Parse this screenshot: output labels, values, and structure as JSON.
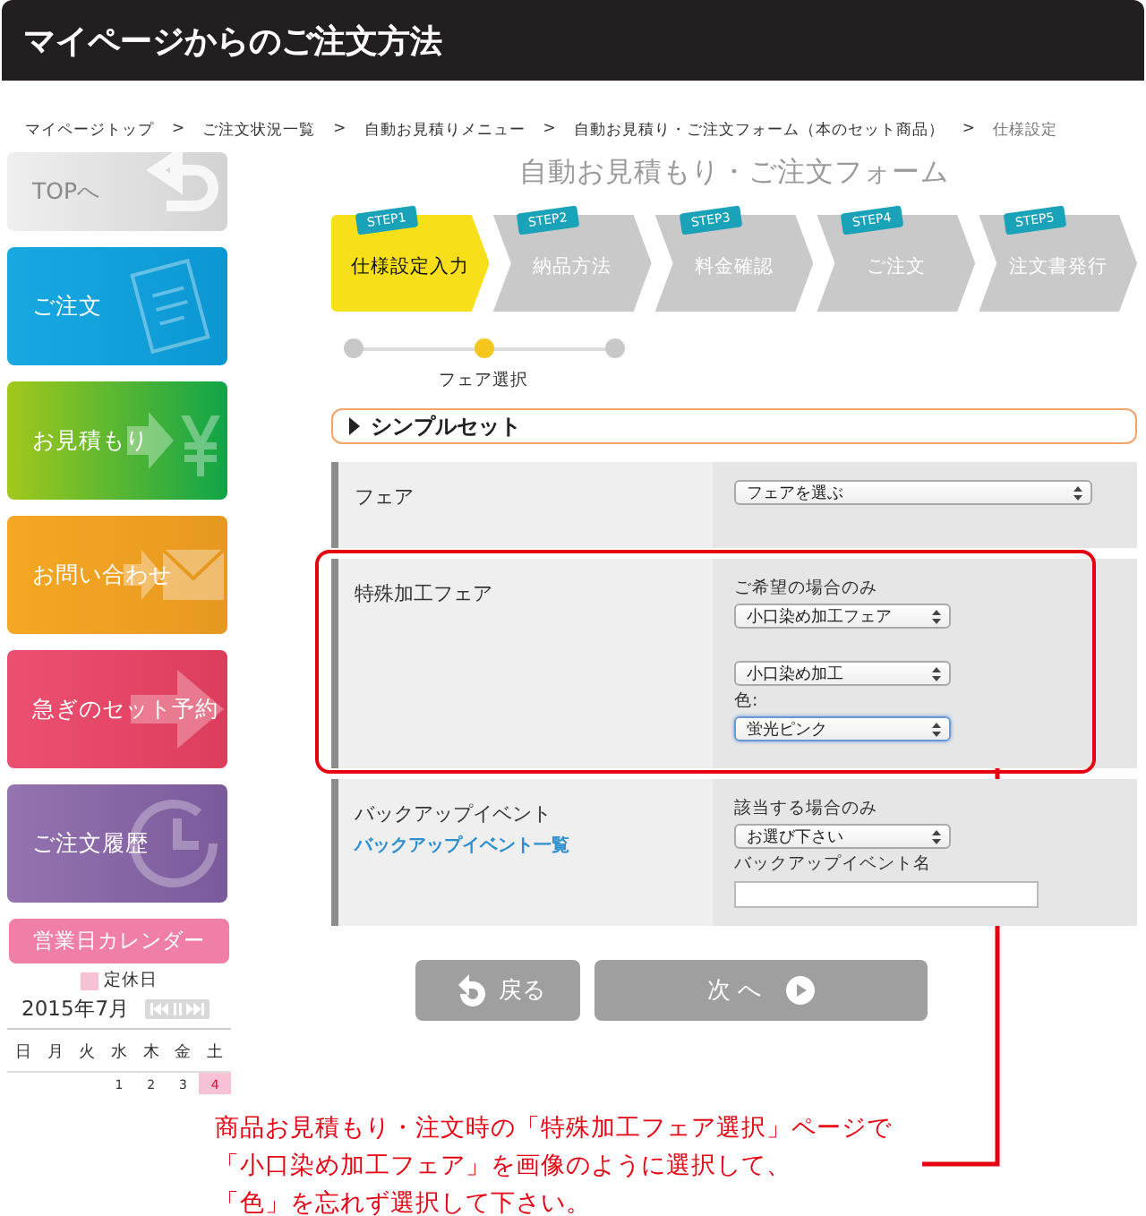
{
  "header": {
    "title": "マイページからのご注文方法"
  },
  "breadcrumb": [
    {
      "label": "マイページトップ"
    },
    {
      "separator": ">",
      "label": "ご注文状況一覧"
    },
    {
      "separator": ">",
      "label": "自動お見積りメニュー"
    },
    {
      "separator": ">",
      "label": "自動お見積り・ご注文フォーム（本のセット商品）"
    },
    {
      "separator": ">",
      "label": "仕様設定",
      "current": true
    }
  ],
  "sidebar": {
    "items": [
      {
        "label": "TOPへ",
        "kind": "top"
      },
      {
        "label": "ご注文",
        "kind": "order"
      },
      {
        "label": "お見積もり",
        "kind": "estimate"
      },
      {
        "label": "お問い合わせ",
        "kind": "contact"
      },
      {
        "label": "急ぎのセット予約",
        "kind": "rush"
      },
      {
        "label": "ご注文履歴",
        "kind": "history"
      }
    ]
  },
  "calendar": {
    "button": "営業日カレンダー",
    "legend": "定休日",
    "month": "2015年7月",
    "weekdays": [
      "日",
      "月",
      "火",
      "水",
      "木",
      "金",
      "土"
    ],
    "days": [
      {
        "label": "1",
        "holiday": false
      },
      {
        "label": "2",
        "holiday": false
      },
      {
        "label": "3",
        "holiday": false
      },
      {
        "label": "4",
        "holiday": true
      }
    ]
  },
  "form": {
    "title": "自動お見積もり・ご注文フォーム",
    "steps": [
      {
        "badge": "STEP1",
        "label": "仕様設定入力",
        "selected": true
      },
      {
        "badge": "STEP2",
        "label": "納品方法",
        "selected": false
      },
      {
        "badge": "STEP3",
        "label": "料金確認",
        "selected": false
      },
      {
        "badge": "STEP4",
        "label": "ご注文",
        "selected": false
      },
      {
        "badge": "STEP5",
        "label": "注文書発行",
        "selected": false
      }
    ],
    "progress": {
      "label": "フェア選択",
      "dots": [
        {
          "selected": false
        },
        {
          "selected": true
        },
        {
          "selected": false
        }
      ]
    },
    "section": {
      "title": "シンプルセット"
    },
    "rows": [
      {
        "label": "フェア",
        "highlighted": false,
        "fields": [
          {
            "kind": "longselect",
            "value": "フェアを選ぶ",
            "focused": false
          }
        ]
      },
      {
        "label": "特殊加工フェア",
        "highlighted": true,
        "fields": [
          {
            "kind": "note",
            "text": "ご希望の場合のみ"
          },
          {
            "kind": "select",
            "value": "小口染め加工フェア",
            "focused": false
          },
          {
            "kind": "select",
            "value": "小口染め加工",
            "focused": false
          },
          {
            "kind": "note",
            "text": "色:"
          },
          {
            "kind": "select",
            "value": "蛍光ピンク",
            "focused": true
          }
        ]
      },
      {
        "label": "バックアップイベント",
        "link": "バックアップイベント一覧",
        "highlighted": false,
        "fields": [
          {
            "kind": "note",
            "text": "該当する場合のみ"
          },
          {
            "kind": "select",
            "value": "お選び下さい",
            "focused": false
          },
          {
            "kind": "note",
            "text": "バックアップイベント名"
          },
          {
            "kind": "input"
          }
        ]
      }
    ],
    "buttons": [
      {
        "label": "戻る",
        "kind": "back"
      },
      {
        "label": "次 へ",
        "kind": "next"
      }
    ]
  },
  "note": {
    "lines": [
      "商品お見積もり・注文時の「特殊加工フェア選択」ページで",
      "「小口染め加工フェア」を画像のように選択して、",
      "「色」を忘れず選択して下さい。"
    ]
  }
}
